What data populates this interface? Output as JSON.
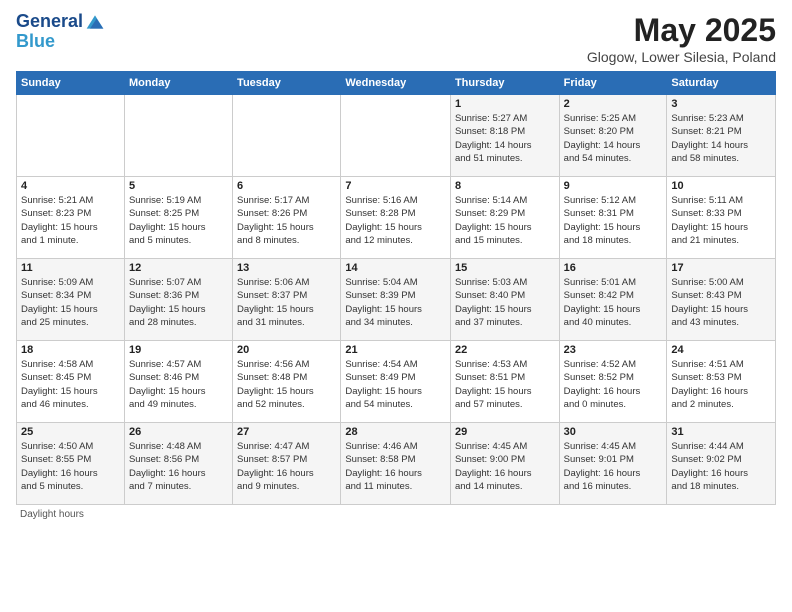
{
  "header": {
    "logo_line1": "General",
    "logo_line2": "Blue",
    "title": "May 2025",
    "subtitle": "Glogow, Lower Silesia, Poland"
  },
  "days_of_week": [
    "Sunday",
    "Monday",
    "Tuesday",
    "Wednesday",
    "Thursday",
    "Friday",
    "Saturday"
  ],
  "footer": "Daylight hours",
  "weeks": [
    [
      {
        "day": "",
        "info": ""
      },
      {
        "day": "",
        "info": ""
      },
      {
        "day": "",
        "info": ""
      },
      {
        "day": "",
        "info": ""
      },
      {
        "day": "1",
        "info": "Sunrise: 5:27 AM\nSunset: 8:18 PM\nDaylight: 14 hours\nand 51 minutes."
      },
      {
        "day": "2",
        "info": "Sunrise: 5:25 AM\nSunset: 8:20 PM\nDaylight: 14 hours\nand 54 minutes."
      },
      {
        "day": "3",
        "info": "Sunrise: 5:23 AM\nSunset: 8:21 PM\nDaylight: 14 hours\nand 58 minutes."
      }
    ],
    [
      {
        "day": "4",
        "info": "Sunrise: 5:21 AM\nSunset: 8:23 PM\nDaylight: 15 hours\nand 1 minute."
      },
      {
        "day": "5",
        "info": "Sunrise: 5:19 AM\nSunset: 8:25 PM\nDaylight: 15 hours\nand 5 minutes."
      },
      {
        "day": "6",
        "info": "Sunrise: 5:17 AM\nSunset: 8:26 PM\nDaylight: 15 hours\nand 8 minutes."
      },
      {
        "day": "7",
        "info": "Sunrise: 5:16 AM\nSunset: 8:28 PM\nDaylight: 15 hours\nand 12 minutes."
      },
      {
        "day": "8",
        "info": "Sunrise: 5:14 AM\nSunset: 8:29 PM\nDaylight: 15 hours\nand 15 minutes."
      },
      {
        "day": "9",
        "info": "Sunrise: 5:12 AM\nSunset: 8:31 PM\nDaylight: 15 hours\nand 18 minutes."
      },
      {
        "day": "10",
        "info": "Sunrise: 5:11 AM\nSunset: 8:33 PM\nDaylight: 15 hours\nand 21 minutes."
      }
    ],
    [
      {
        "day": "11",
        "info": "Sunrise: 5:09 AM\nSunset: 8:34 PM\nDaylight: 15 hours\nand 25 minutes."
      },
      {
        "day": "12",
        "info": "Sunrise: 5:07 AM\nSunset: 8:36 PM\nDaylight: 15 hours\nand 28 minutes."
      },
      {
        "day": "13",
        "info": "Sunrise: 5:06 AM\nSunset: 8:37 PM\nDaylight: 15 hours\nand 31 minutes."
      },
      {
        "day": "14",
        "info": "Sunrise: 5:04 AM\nSunset: 8:39 PM\nDaylight: 15 hours\nand 34 minutes."
      },
      {
        "day": "15",
        "info": "Sunrise: 5:03 AM\nSunset: 8:40 PM\nDaylight: 15 hours\nand 37 minutes."
      },
      {
        "day": "16",
        "info": "Sunrise: 5:01 AM\nSunset: 8:42 PM\nDaylight: 15 hours\nand 40 minutes."
      },
      {
        "day": "17",
        "info": "Sunrise: 5:00 AM\nSunset: 8:43 PM\nDaylight: 15 hours\nand 43 minutes."
      }
    ],
    [
      {
        "day": "18",
        "info": "Sunrise: 4:58 AM\nSunset: 8:45 PM\nDaylight: 15 hours\nand 46 minutes."
      },
      {
        "day": "19",
        "info": "Sunrise: 4:57 AM\nSunset: 8:46 PM\nDaylight: 15 hours\nand 49 minutes."
      },
      {
        "day": "20",
        "info": "Sunrise: 4:56 AM\nSunset: 8:48 PM\nDaylight: 15 hours\nand 52 minutes."
      },
      {
        "day": "21",
        "info": "Sunrise: 4:54 AM\nSunset: 8:49 PM\nDaylight: 15 hours\nand 54 minutes."
      },
      {
        "day": "22",
        "info": "Sunrise: 4:53 AM\nSunset: 8:51 PM\nDaylight: 15 hours\nand 57 minutes."
      },
      {
        "day": "23",
        "info": "Sunrise: 4:52 AM\nSunset: 8:52 PM\nDaylight: 16 hours\nand 0 minutes."
      },
      {
        "day": "24",
        "info": "Sunrise: 4:51 AM\nSunset: 8:53 PM\nDaylight: 16 hours\nand 2 minutes."
      }
    ],
    [
      {
        "day": "25",
        "info": "Sunrise: 4:50 AM\nSunset: 8:55 PM\nDaylight: 16 hours\nand 5 minutes."
      },
      {
        "day": "26",
        "info": "Sunrise: 4:48 AM\nSunset: 8:56 PM\nDaylight: 16 hours\nand 7 minutes."
      },
      {
        "day": "27",
        "info": "Sunrise: 4:47 AM\nSunset: 8:57 PM\nDaylight: 16 hours\nand 9 minutes."
      },
      {
        "day": "28",
        "info": "Sunrise: 4:46 AM\nSunset: 8:58 PM\nDaylight: 16 hours\nand 11 minutes."
      },
      {
        "day": "29",
        "info": "Sunrise: 4:45 AM\nSunset: 9:00 PM\nDaylight: 16 hours\nand 14 minutes."
      },
      {
        "day": "30",
        "info": "Sunrise: 4:45 AM\nSunset: 9:01 PM\nDaylight: 16 hours\nand 16 minutes."
      },
      {
        "day": "31",
        "info": "Sunrise: 4:44 AM\nSunset: 9:02 PM\nDaylight: 16 hours\nand 18 minutes."
      }
    ]
  ]
}
